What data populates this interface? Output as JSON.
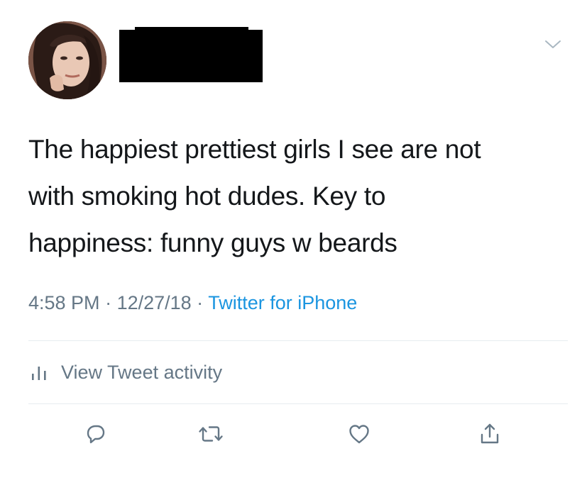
{
  "tweet": {
    "text_lines": [
      "The happiest prettiest girls I see are not",
      "with smoking hot dudes. Key to",
      "happiness: funny guys w beards"
    ],
    "time": "4:58 PM",
    "separator": " · ",
    "date": "12/27/18",
    "source": "Twitter for iPhone",
    "activity_label": "View Tweet activity"
  },
  "icons": {
    "menu": "chevron-down-icon",
    "activity": "bar-chart-icon",
    "reply": "reply-icon",
    "retweet": "retweet-icon",
    "like": "heart-icon",
    "share": "share-icon"
  },
  "colors": {
    "text": "#14171a",
    "muted": "#657786",
    "link": "#1b95e0",
    "divider": "#e6ecf0",
    "icon": "#657786"
  }
}
